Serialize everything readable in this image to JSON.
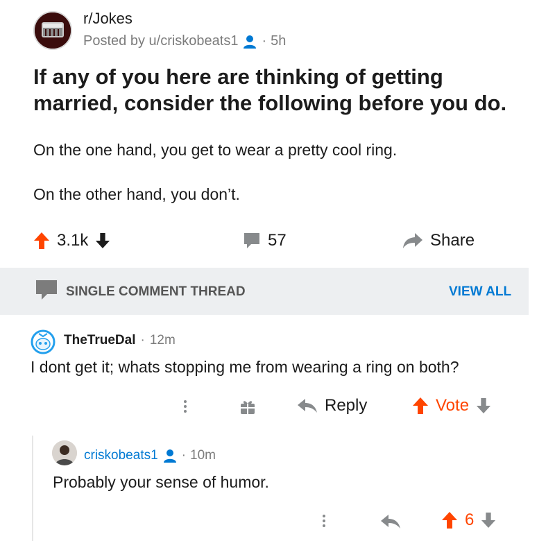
{
  "post": {
    "subreddit": "r/Jokes",
    "posted_prefix": "Posted by ",
    "author": "u/criskobeats1",
    "age": "5h",
    "title": "If any of you here are thinking of getting married, consider the following before you do.",
    "body": [
      "On the one hand, you get to wear a pretty cool ring.",
      "On the other hand, you don’t."
    ],
    "upvotes": "3.1k",
    "comments": "57",
    "share_label": "Share"
  },
  "thread_bar": {
    "label": "SINGLE COMMENT THREAD",
    "view_all": "VIEW ALL"
  },
  "comments": [
    {
      "user": "TheTrueDal",
      "age": "12m",
      "text": "I dont get it; whats stopping me from wearing a ring on both?",
      "reply_label": "Reply",
      "vote_label": "Vote"
    },
    {
      "user": "criskobeats1",
      "age": "10m",
      "text": "Probably your sense of humor.",
      "score": "6"
    }
  ],
  "colors": {
    "accent": "#ff4500",
    "link": "#0079d3",
    "muted": "#7c7c7c"
  },
  "icons": [
    "upvote-icon",
    "downvote-icon",
    "comment-icon",
    "share-icon",
    "award-icon",
    "reply-icon",
    "more-icon",
    "user-icon"
  ]
}
